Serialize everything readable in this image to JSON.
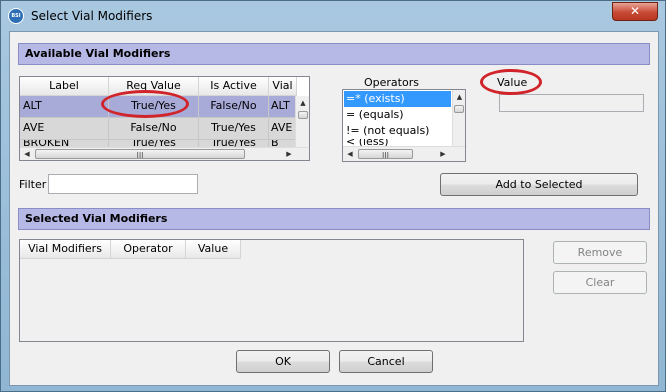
{
  "window": {
    "title": "Select Vial Modifiers",
    "close_symbol": "✕",
    "app_icon_text": "BSI"
  },
  "available": {
    "section_title": "Available Vial Modifiers",
    "columns": [
      "Label",
      "Req Value",
      "Is Active",
      "Vial"
    ],
    "rows": [
      [
        "ALT",
        "True/Yes",
        "False/No",
        "ALT"
      ],
      [
        "AVE",
        "False/No",
        "True/Yes",
        "AVE"
      ],
      [
        "BROKEN",
        "True/Yes",
        "True/Yes",
        "B"
      ]
    ],
    "selected_row": 0,
    "scroll_thumb_grip": "III"
  },
  "operators": {
    "label": "Operators",
    "items": [
      "=* (exists)",
      "= (equals)",
      "!= (not equals)",
      "< (less)"
    ],
    "selected_index": 0
  },
  "value": {
    "label": "Value",
    "current": ""
  },
  "filter": {
    "label": "Filter",
    "value": "",
    "add_button": "Add to Selected"
  },
  "selected": {
    "section_title": "Selected Vial Modifiers",
    "columns": [
      "Vial Modifiers",
      "Operator",
      "Value"
    ],
    "rows": [],
    "remove_button": "Remove",
    "clear_button": "Clear"
  },
  "footer": {
    "ok_button": "OK",
    "cancel_button": "Cancel"
  },
  "annotation_color": "#d1232a"
}
